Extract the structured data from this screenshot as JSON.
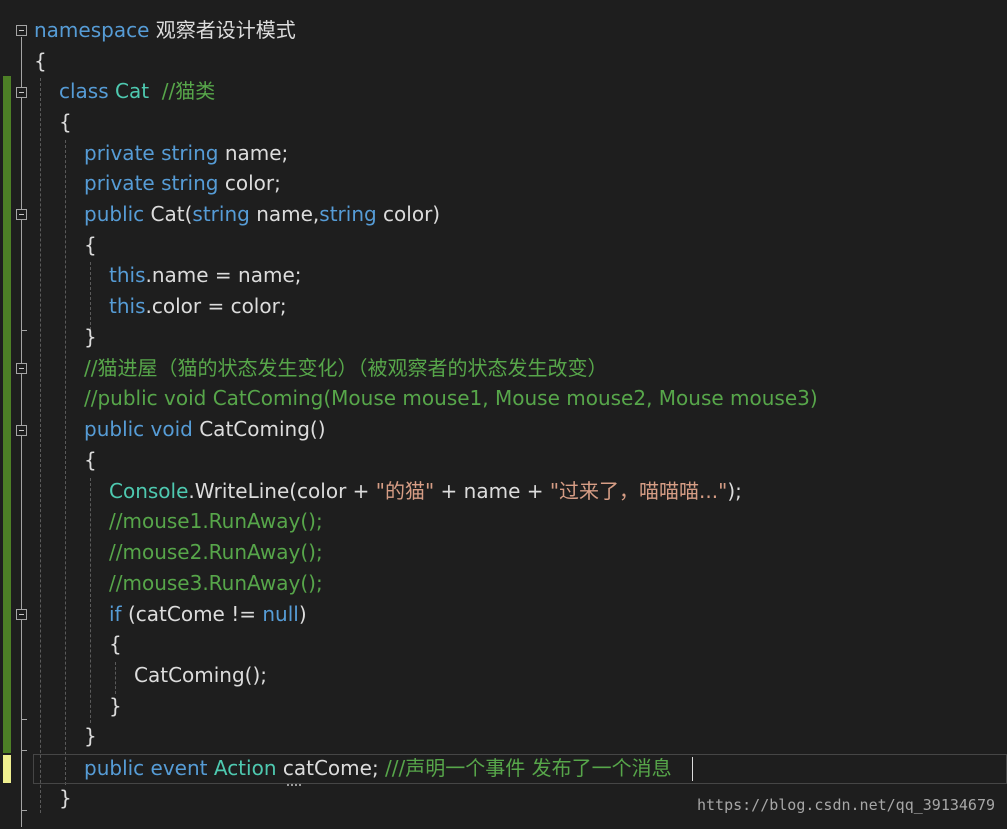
{
  "code": {
    "l1_kw": "namespace",
    "l1_name": " 观察者设计模式",
    "l2": "{",
    "l3_kw": "class",
    "l3_type": "Cat",
    "l3_cm": "  //猫类",
    "l4": "{",
    "l5_kw": "private string",
    "l5_rest": " name;",
    "l6_kw": "private string",
    "l6_rest": " color;",
    "l7_kw": "public",
    "l7_a": " Cat(",
    "l7_kw2": "string",
    "l7_b": " name,",
    "l7_kw3": "string",
    "l7_c": " color)",
    "l8": "{",
    "l9_kw": "this",
    "l9_rest": ".name = name;",
    "l10_kw": "this",
    "l10_rest": ".color = color;",
    "l11": "}",
    "l12_cm": "//猫进屋（猫的状态发生变化）（被观察者的状态发生改变）",
    "l13_cm": "//public void CatComing(Mouse mouse1, Mouse mouse2, Mouse mouse3)",
    "l14_kw": "public void",
    "l14_rest": " CatComing()",
    "l15": "{",
    "l16_type": "Console",
    "l16_a": ".WriteLine(color + ",
    "l16_str1": "\"的猫\"",
    "l16_b": " + name + ",
    "l16_str2": "\"过来了，喵喵喵...\"",
    "l16_c": ");",
    "l17_cm": "//mouse1.RunAway();",
    "l18_cm": "//mouse2.RunAway();",
    "l19_cm": "//mouse3.RunAway();",
    "l20_kw": "if",
    "l20_a": " (catCome != ",
    "l20_kw2": "null",
    "l20_b": ")",
    "l21": "{",
    "l22": "CatComing();",
    "l23": "}",
    "l24": "}",
    "l25_kw": "public event",
    "l25_type": " Action",
    "l25_rest": " catCome; ",
    "l25_cm": "///声明一个事件 发布了一个消息",
    "l26": "}"
  },
  "watermark": "https://blog.csdn.net/qq_39134679",
  "colors": {
    "background": "#1e1e1e",
    "keyword": "#569cd6",
    "type": "#4ec9b0",
    "comment": "#57a64a",
    "string": "#d69d85",
    "text": "#dcdcdc",
    "change_saved": "#4d7f26",
    "change_unsaved": "#efef90"
  }
}
